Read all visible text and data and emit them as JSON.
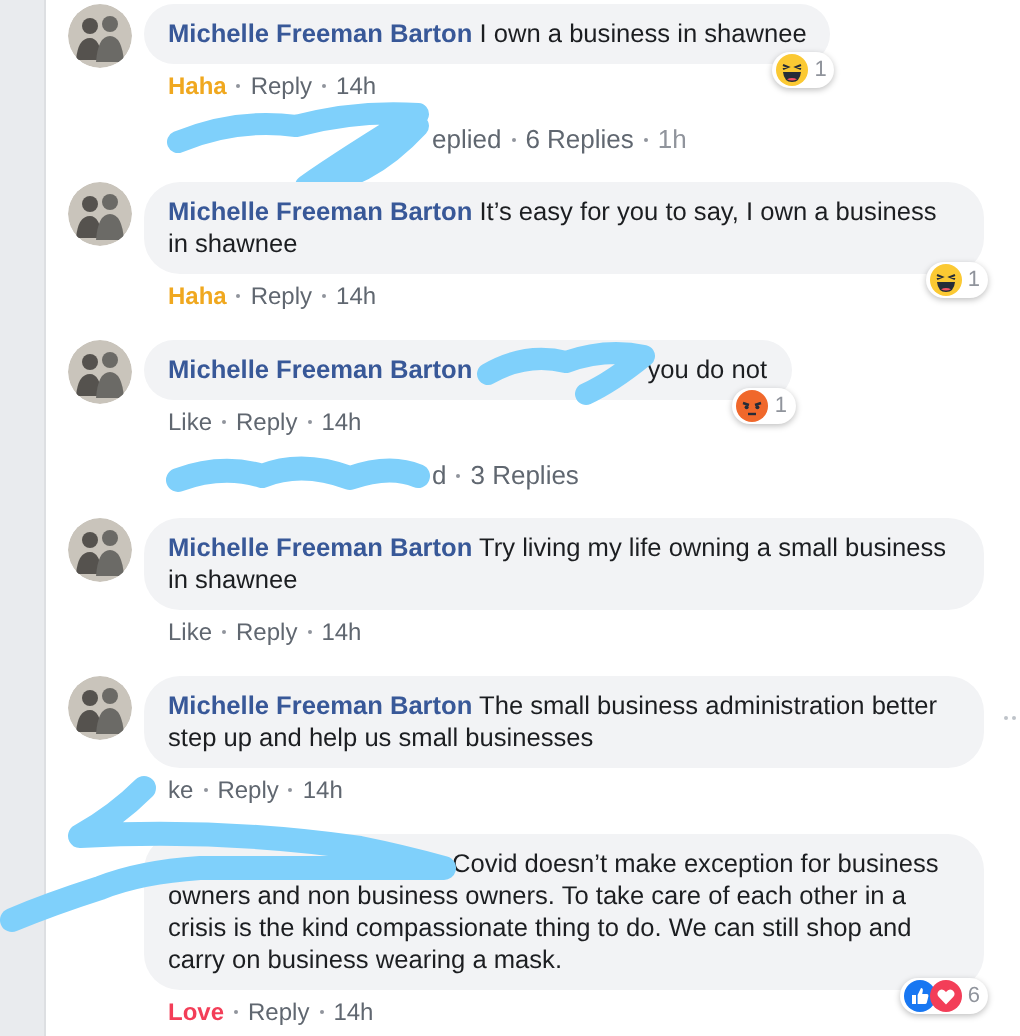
{
  "items": [
    {
      "kind": "comment",
      "avatar": true,
      "author": "Michelle Freeman Barton",
      "text": "I own a business in shawnee",
      "action": {
        "label": "Haha",
        "color": "#f0a81f",
        "reacted": true
      },
      "reply": "Reply",
      "time": "14h",
      "reactions": [
        {
          "kind": "haha"
        }
      ],
      "reaction_count": "1"
    },
    {
      "kind": "replies",
      "redacted": true,
      "text": "eplied",
      "count": "6 Replies",
      "time": "1h"
    },
    {
      "kind": "comment",
      "avatar": true,
      "author": "Michelle Freeman Barton",
      "text": "It’s easy for you to say, I own a business in shawnee",
      "action": {
        "label": "Haha",
        "color": "#f0a81f",
        "reacted": true
      },
      "reply": "Reply",
      "time": "14h",
      "reactions": [
        {
          "kind": "haha"
        }
      ],
      "reaction_count": "1"
    },
    {
      "kind": "comment",
      "avatar": true,
      "author": "Michelle Freeman Barton",
      "redacted": true,
      "text": "you do not",
      "action": {
        "label": "Like",
        "color": "#606770",
        "reacted": false
      },
      "reply": "Reply",
      "time": "14h",
      "reactions": [
        {
          "kind": "angry"
        }
      ],
      "reaction_count": "1"
    },
    {
      "kind": "replies",
      "redacted": true,
      "text": "d",
      "count": "3 Replies"
    },
    {
      "kind": "comment",
      "avatar": true,
      "author": "Michelle Freeman Barton",
      "text": "Try living my life owning a small business in shawnee",
      "action": {
        "label": "Like",
        "color": "#606770",
        "reacted": false
      },
      "reply": "Reply",
      "time": "14h"
    },
    {
      "kind": "comment",
      "avatar": true,
      "author": "Michelle Freeman Barton",
      "text": "The small business administration better step up and help us small businesses",
      "action": {
        "label": "ke",
        "color": "#606770",
        "reacted": false
      },
      "reply": "Reply",
      "time": "14h",
      "options": true
    },
    {
      "kind": "comment",
      "avatar": false,
      "redacted": true,
      "text": "Covid doesn’t make exception for business owners and non business owners. To take care of each other in a crisis is the kind compassionate thing to do. We can still shop and carry on business wearing a mask.",
      "action": {
        "label": "Love",
        "color": "#f33e58",
        "reacted": true
      },
      "reply": "Reply",
      "time": "14h",
      "reactions": [
        {
          "kind": "like"
        },
        {
          "kind": "love"
        }
      ],
      "reaction_count": "6"
    }
  ]
}
